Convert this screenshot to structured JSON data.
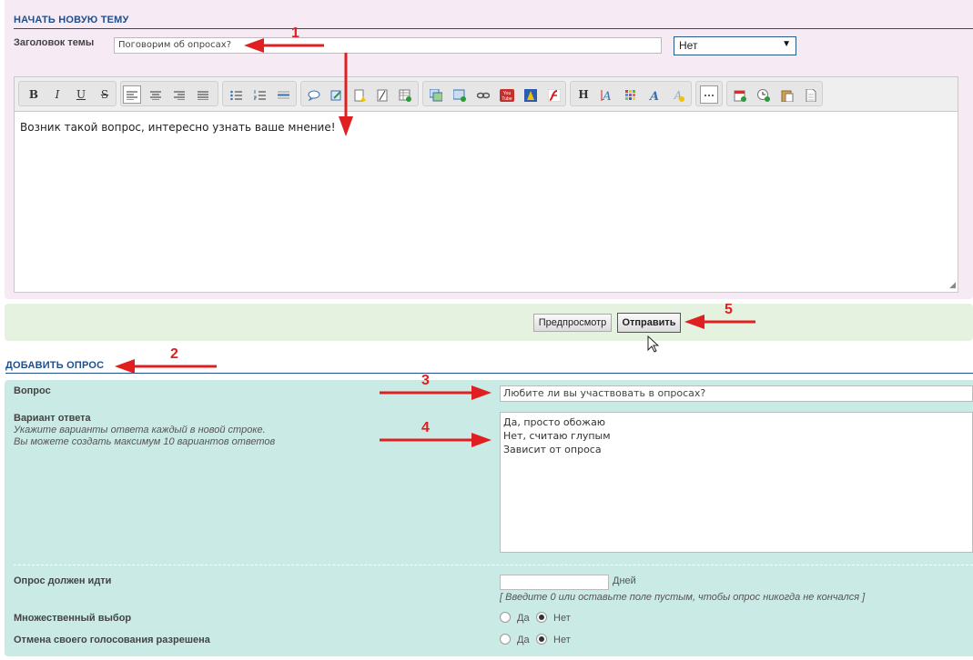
{
  "topic": {
    "section_title": "НАЧАТЬ НОВУЮ ТЕМУ",
    "subject_label": "Заголовок темы",
    "subject_value": "Поговорим об опросах?",
    "select_value": "Нет",
    "message_text": "Возник такой вопрос, интересно узнать ваше мнение!"
  },
  "toolbar": {
    "bold": "B",
    "italic": "I",
    "underline": "U",
    "strike": "S",
    "heading": "H"
  },
  "buttons": {
    "preview": "Предпросмотр",
    "submit": "Отправить"
  },
  "poll": {
    "section_title": "ДОБАВИТЬ ОПРОС",
    "question_label": "Вопрос",
    "question_value": "Любите ли вы участвовать в опросах?",
    "answers_label": "Вариант ответа",
    "answers_hint_1": "Укажите варианты ответа каждый в новой строке.",
    "answers_hint_2": "Вы можете создать максимум 10 вариантов ответов",
    "answers": [
      "Да, просто обожаю",
      "Нет, считаю глупым",
      "Зависит от опроса"
    ],
    "duration_label": "Опрос должен идти",
    "duration_unit": "Дней",
    "duration_hint": "[ Введите 0 или оставьте поле пустым, чтобы опрос никогда не кончался ]",
    "multi_label": "Множественный выбор",
    "revote_label": "Отмена своего голосования разрешена",
    "yes": "Да",
    "no": "Нет"
  },
  "annotations": [
    "1",
    "2",
    "3",
    "4",
    "5"
  ],
  "colors": {
    "accent": "#1e4f8c",
    "annotation_red": "#e02020",
    "topic_bg": "#f6eaf5",
    "submit_bg": "#e6f2e0",
    "poll_bg": "#caeae5"
  }
}
